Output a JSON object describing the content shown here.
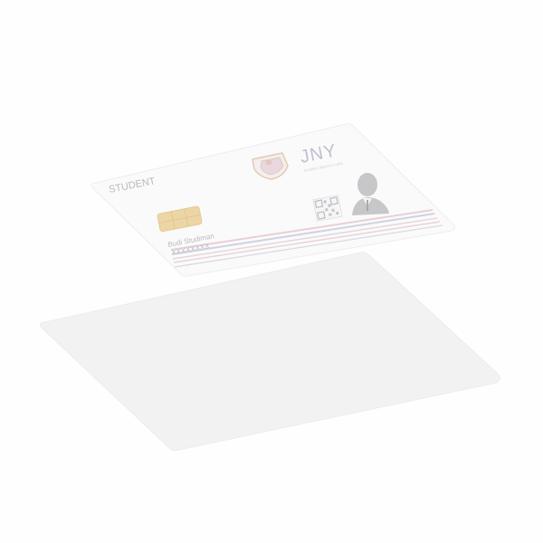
{
  "card": {
    "role_label": "STUDENT",
    "brand_text": "JNY",
    "brand_subtitle": "STUDENT IDENTITY CARD",
    "holder_name": "Budi Studiman",
    "holder_id": "XXXXXXXX"
  },
  "icons": {
    "crest": "university-crest-icon",
    "chip": "chip-icon",
    "qr": "qr-code-icon",
    "avatar": "person-silhouette-icon"
  },
  "colors": {
    "background": "#fefefe",
    "card": "#fbfafb",
    "base": "#f3f3f4",
    "text": "#b9b9bd",
    "stripe_pink": "#e8cfd5",
    "stripe_blue": "#cfd3e0",
    "chip": "#ecd6a6",
    "silhouette": "#c7c7c9"
  }
}
